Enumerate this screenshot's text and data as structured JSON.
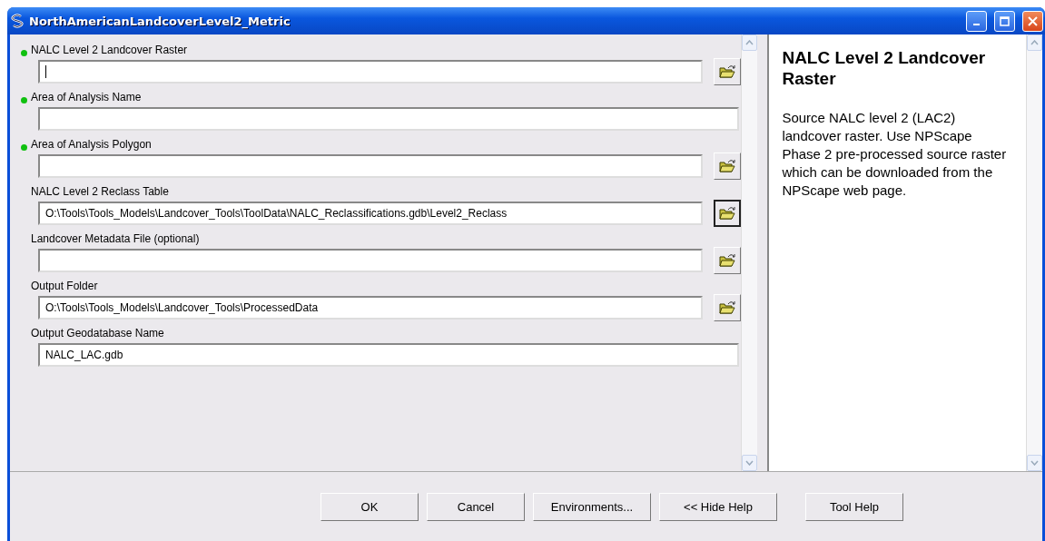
{
  "window": {
    "title": "NorthAmericanLandcoverLevel2_Metric"
  },
  "parameters": [
    {
      "label": "NALC Level 2 Landcover Raster",
      "required": true,
      "cursor": true,
      "browse": true,
      "browse_focused": false
    },
    {
      "label": "Area of Analysis Name",
      "required": true,
      "cursor": false,
      "browse": false
    },
    {
      "label": "Area of Analysis Polygon",
      "required": true,
      "cursor": false,
      "browse": true,
      "browse_focused": false
    },
    {
      "label": "NALC Level 2 Reclass Table",
      "required": false,
      "value": "O:\\Tools\\Tools_Models\\Landcover_Tools\\ToolData\\NALC_Reclassifications.gdb\\Level2_Reclass",
      "cursor": false,
      "browse": true,
      "browse_focused": true
    },
    {
      "label": "Landcover Metadata File (optional)",
      "required": false,
      "cursor": false,
      "browse": true,
      "browse_focused": false
    },
    {
      "label": "Output Folder",
      "required": false,
      "value": "O:\\Tools\\Tools_Models\\Landcover_Tools\\ProcessedData",
      "cursor": false,
      "browse": true,
      "browse_focused": false
    },
    {
      "label": "Output Geodatabase Name",
      "required": false,
      "value": "NALC_LAC.gdb",
      "cursor": false,
      "browse": false
    }
  ],
  "help": {
    "title": "NALC Level 2 Landcover Raster",
    "text": "Source NALC level 2 (LAC2) landcover raster. Use NPScape Phase 2 pre-processed source raster which can be downloaded from the NPScape web page."
  },
  "buttons": [
    "OK",
    "Cancel",
    "Environments...",
    "<< Hide Help",
    "Tool Help"
  ]
}
